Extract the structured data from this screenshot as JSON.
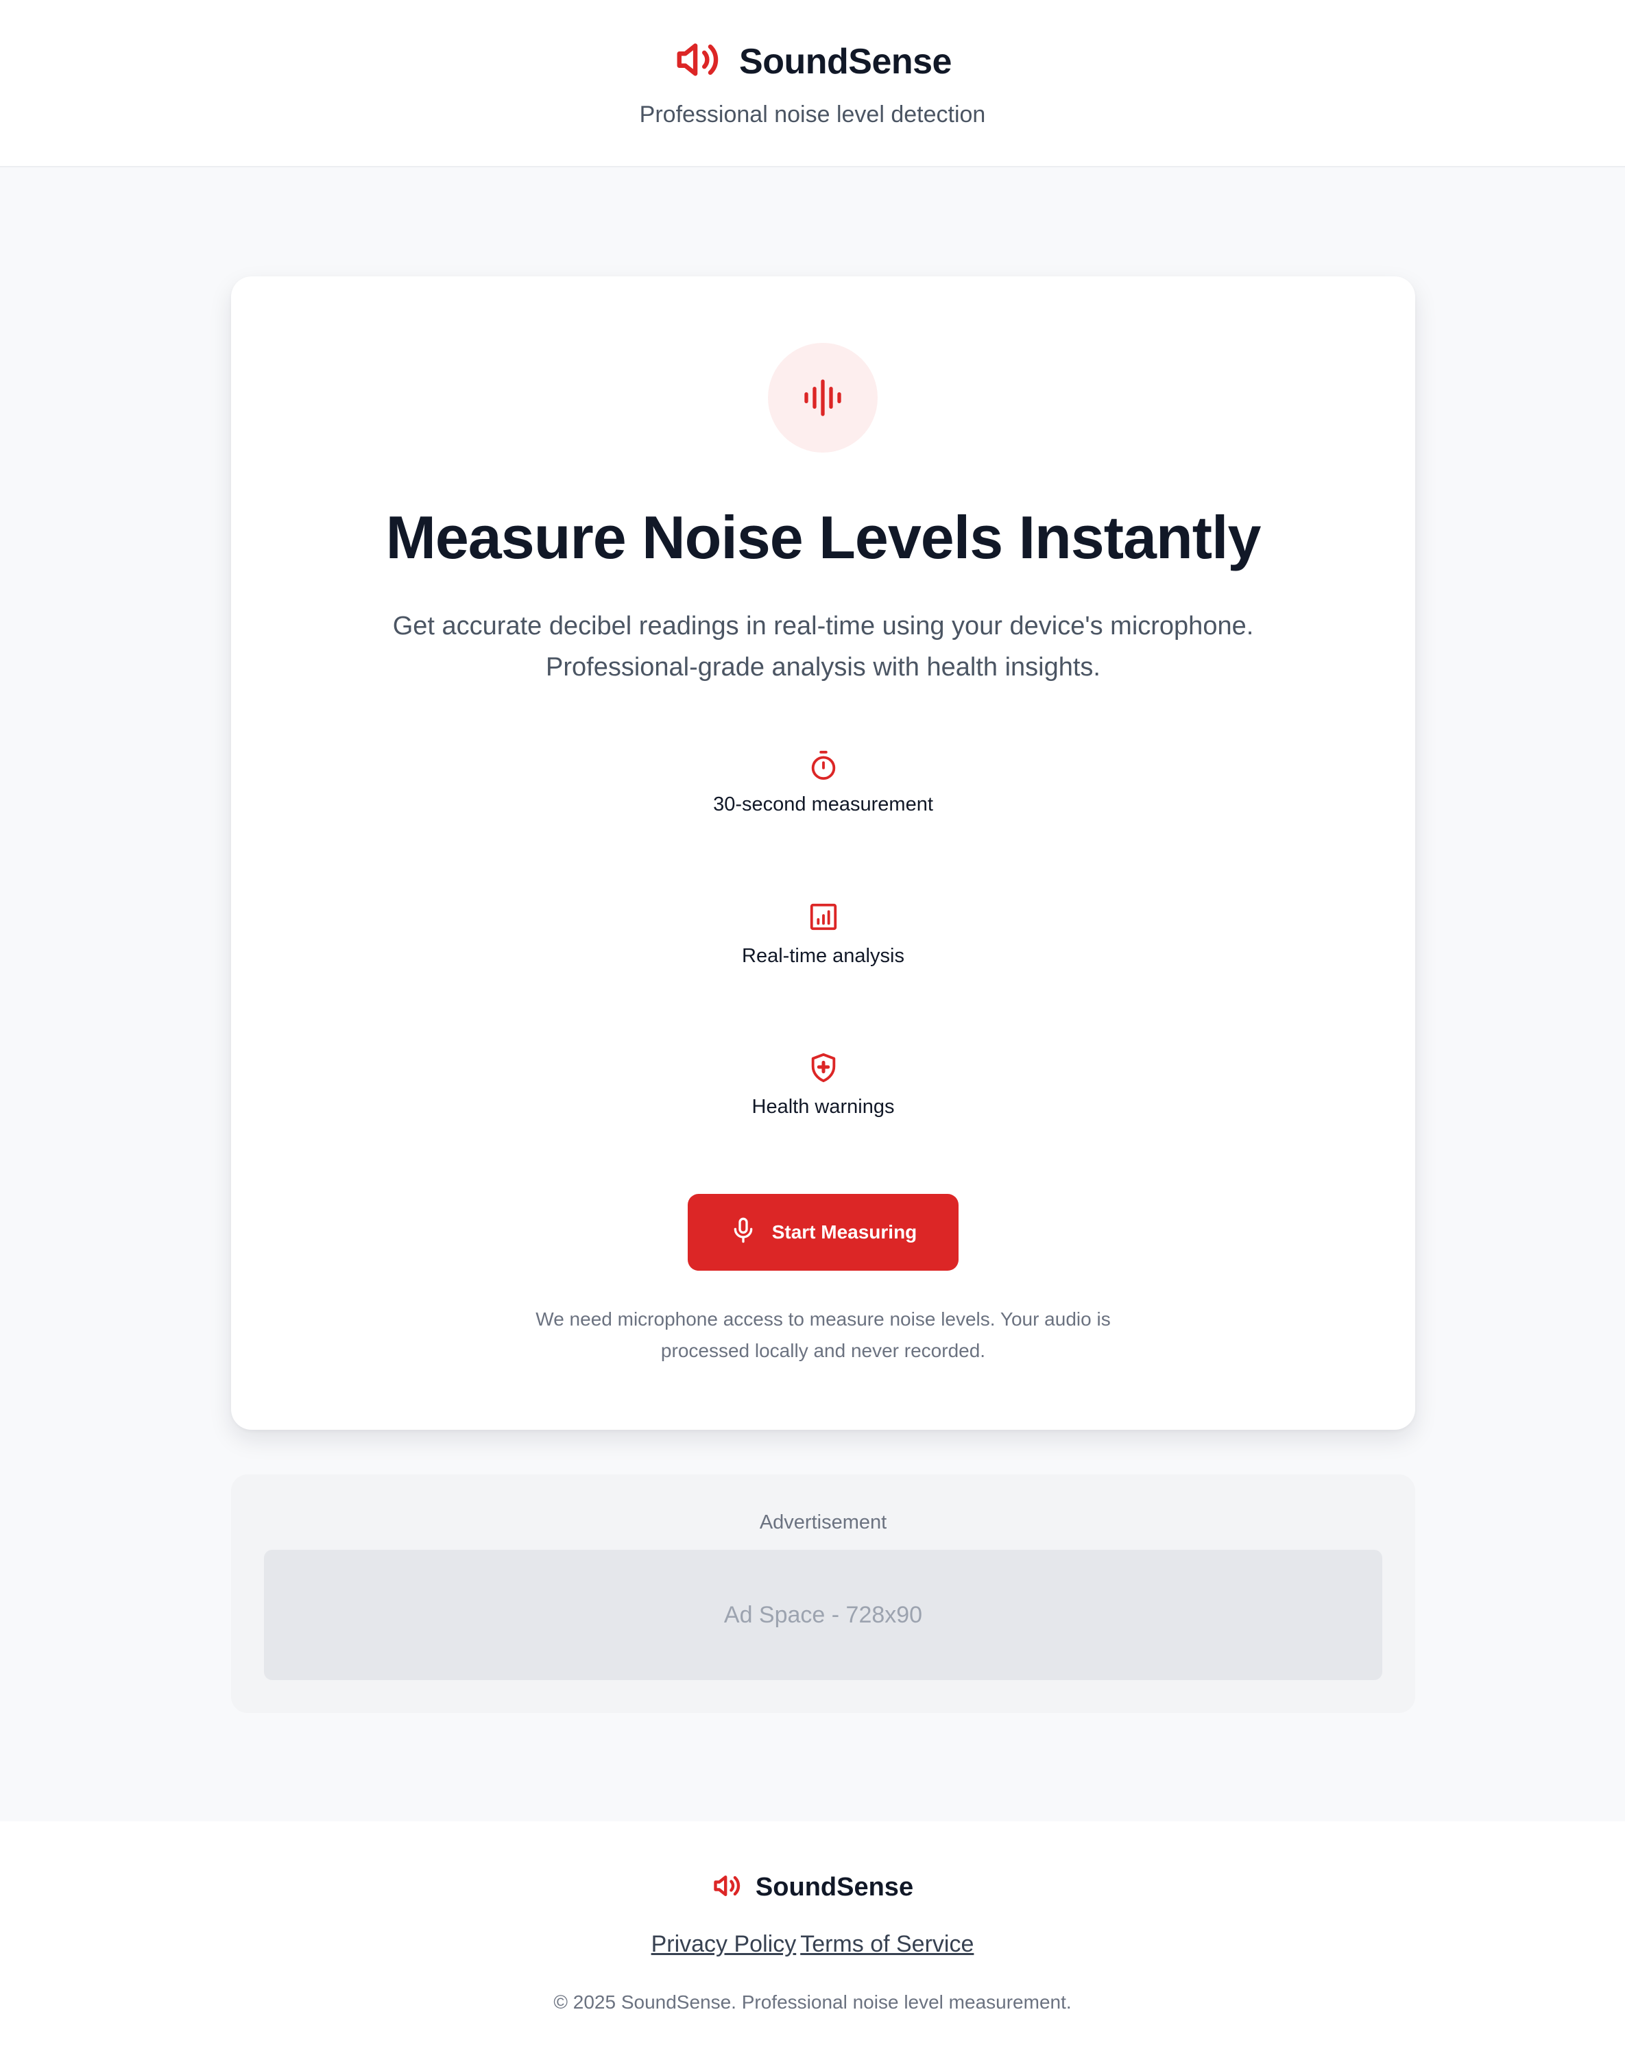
{
  "header": {
    "app_name": "SoundSense",
    "tagline": "Professional noise level detection"
  },
  "hero": {
    "headline": "Measure Noise Levels Instantly",
    "subtext": "Get accurate decibel readings in real-time using your device's microphone. Professional-grade analysis with health insights."
  },
  "features": [
    {
      "icon": "timer-icon",
      "label": "30-second measurement"
    },
    {
      "icon": "bar-chart-icon",
      "label": "Real-time analysis"
    },
    {
      "icon": "shield-plus-icon",
      "label": "Health warnings"
    }
  ],
  "actions": {
    "start_label": "Start Measuring"
  },
  "note": "We need microphone access to measure noise levels. Your audio is processed locally and never recorded.",
  "ad": {
    "title": "Advertisement",
    "placeholder": "Ad Space - 728x90"
  },
  "footer": {
    "app_name": "SoundSense",
    "links": [
      "Privacy Policy",
      "Terms of Service"
    ],
    "copyright": "© 2025 SoundSense. Professional noise level measurement."
  },
  "colors": {
    "accent": "#dc2626",
    "accent_soft": "#fdeeee",
    "text": "#111827",
    "muted": "#6b7280",
    "page_bg": "#f8f9fb"
  }
}
